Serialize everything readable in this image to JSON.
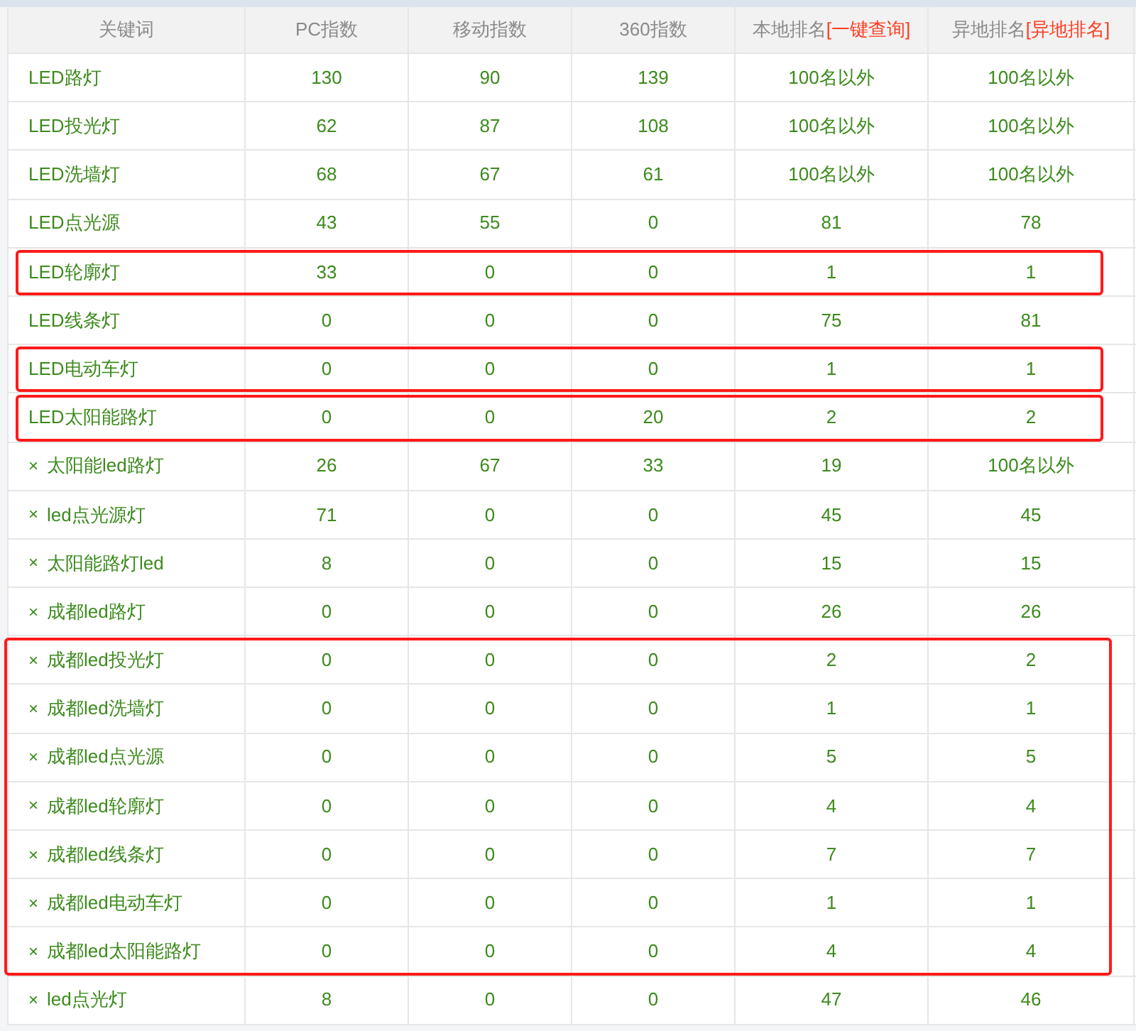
{
  "columns": [
    {
      "label": "关键词"
    },
    {
      "label": "PC指数"
    },
    {
      "label": "移动指数"
    },
    {
      "label": "360指数"
    },
    {
      "label": "本地排名",
      "link": "[一键查询]"
    },
    {
      "label": "异地排名",
      "link": "[异地排名]"
    }
  ],
  "groups": [
    {
      "highlighted": false,
      "rows": [
        {
          "keyword": "LED路灯",
          "cells": [
            "130",
            "90",
            "139",
            "100名以外",
            "100名以外"
          ]
        },
        {
          "keyword": "LED投光灯",
          "cells": [
            "62",
            "87",
            "108",
            "100名以外",
            "100名以外"
          ]
        },
        {
          "keyword": "LED洗墙灯",
          "cells": [
            "68",
            "67",
            "61",
            "100名以外",
            "100名以外"
          ]
        },
        {
          "keyword": "LED点光源",
          "cells": [
            "43",
            "55",
            "0",
            "81",
            "78"
          ]
        }
      ]
    },
    {
      "highlighted": true,
      "rows": [
        {
          "keyword": "LED轮廓灯",
          "cells": [
            "33",
            "0",
            "0",
            "1",
            "1"
          ]
        }
      ]
    },
    {
      "highlighted": false,
      "rows": [
        {
          "keyword": "LED线条灯",
          "cells": [
            "0",
            "0",
            "0",
            "75",
            "81"
          ]
        }
      ]
    },
    {
      "highlighted": true,
      "rows": [
        {
          "keyword": "LED电动车灯",
          "cells": [
            "0",
            "0",
            "0",
            "1",
            "1"
          ]
        }
      ]
    },
    {
      "highlighted": true,
      "rows": [
        {
          "keyword": "LED太阳能路灯",
          "cells": [
            "0",
            "0",
            "20",
            "2",
            "2"
          ]
        }
      ]
    },
    {
      "highlighted": false,
      "rows": [
        {
          "remove": "×",
          "keyword": "太阳能led路灯",
          "cells": [
            "26",
            "67",
            "33",
            "19",
            "100名以外"
          ]
        },
        {
          "remove": "×",
          "keyword": "led点光源灯",
          "cells": [
            "71",
            "0",
            "0",
            "45",
            "45"
          ]
        },
        {
          "remove": "×",
          "keyword": "太阳能路灯led",
          "cells": [
            "8",
            "0",
            "0",
            "15",
            "15"
          ]
        },
        {
          "remove": "×",
          "keyword": "成都led路灯",
          "cells": [
            "0",
            "0",
            "0",
            "26",
            "26"
          ]
        }
      ]
    },
    {
      "highlighted": true,
      "rows": [
        {
          "remove": "×",
          "keyword": "成都led投光灯",
          "cells": [
            "0",
            "0",
            "0",
            "2",
            "2"
          ]
        },
        {
          "remove": "×",
          "keyword": "成都led洗墙灯",
          "cells": [
            "0",
            "0",
            "0",
            "1",
            "1"
          ]
        },
        {
          "remove": "×",
          "keyword": "成都led点光源",
          "cells": [
            "0",
            "0",
            "0",
            "5",
            "5"
          ]
        },
        {
          "remove": "×",
          "keyword": "成都led轮廓灯",
          "cells": [
            "0",
            "0",
            "0",
            "4",
            "4"
          ]
        },
        {
          "remove": "×",
          "keyword": "成都led线条灯",
          "cells": [
            "0",
            "0",
            "0",
            "7",
            "7"
          ]
        },
        {
          "remove": "×",
          "keyword": "成都led电动车灯",
          "cells": [
            "0",
            "0",
            "0",
            "1",
            "1"
          ]
        },
        {
          "remove": "×",
          "keyword": "成都led太阳能路灯",
          "cells": [
            "0",
            "0",
            "0",
            "4",
            "4"
          ]
        }
      ]
    },
    {
      "highlighted": false,
      "rows": [
        {
          "remove": "×",
          "keyword": "led点光灯",
          "cells": [
            "8",
            "0",
            "0",
            "47",
            "46"
          ]
        }
      ]
    }
  ]
}
